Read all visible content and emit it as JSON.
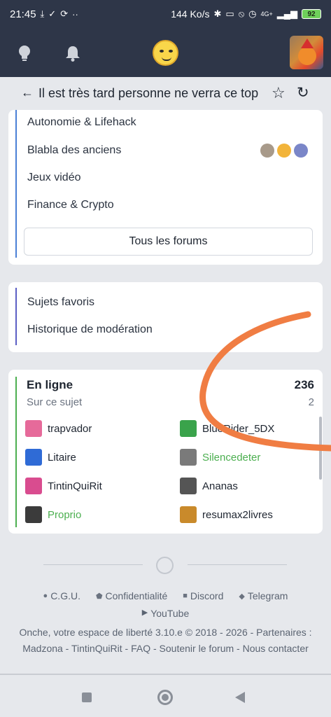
{
  "status_bar": {
    "time": "21:45",
    "left_icons": [
      "download-icon",
      "check-icon",
      "sync-icon",
      "more-icon"
    ],
    "speed": "144 Ko/s",
    "network": "4G+",
    "battery": "92"
  },
  "app_bar": {
    "icons": [
      "lightbulb-icon",
      "bell-icon",
      "logo-smiley-icon",
      "user-avatar"
    ]
  },
  "topic": {
    "back_icon": "←",
    "title": "Il est très tard personne ne verra ce top",
    "star_icon": "☆",
    "refresh_icon": "↻"
  },
  "forums": {
    "items": [
      "Autonomie & Lifehack",
      "Blabla des anciens",
      "Jeux vidéo",
      "Finance & Crypto"
    ],
    "all_button": "Tous les forums"
  },
  "links": {
    "items": [
      "Sujets favoris",
      "Historique de modération"
    ]
  },
  "online": {
    "title": "En ligne",
    "count": "236",
    "subtitle": "Sur ce sujet",
    "subtitle_count": "2",
    "users": [
      {
        "name": "trapvador",
        "moderator": false,
        "color": "#e66a9a"
      },
      {
        "name": "BlueRider_5DX",
        "moderator": false,
        "color": "#3aa34b"
      },
      {
        "name": "Litaire",
        "moderator": false,
        "color": "#2f6bd6"
      },
      {
        "name": "Silencedeter",
        "moderator": true,
        "color": "#7a7a7a"
      },
      {
        "name": "TintinQuiRit",
        "moderator": false,
        "color": "#d94c8f"
      },
      {
        "name": "Ananas",
        "moderator": false,
        "color": "#555555"
      },
      {
        "name": "Proprio",
        "moderator": true,
        "color": "#3b3b3b"
      },
      {
        "name": "resumax2livres",
        "moderator": false,
        "color": "#c98a2b"
      }
    ]
  },
  "footer": {
    "links": [
      "C.G.U.",
      "Confidentialité",
      "Discord",
      "Telegram"
    ],
    "youtube": "YouTube",
    "line1": "Onche, votre espace de liberté 3.10.e © 2018 - 2026 - Partenaires :",
    "partners": [
      "Madzona",
      "TintinQuiRit",
      "FAQ",
      "Soutenir le forum",
      "Nous contacter"
    ]
  },
  "colors": {
    "header_bg": "#2e3648",
    "forum_accent": "#4a7fd6",
    "links_accent": "#5b5ec4",
    "online_accent": "#4caf50",
    "moderator_name": "#4caf50",
    "annotation_stroke": "#f07d43"
  }
}
